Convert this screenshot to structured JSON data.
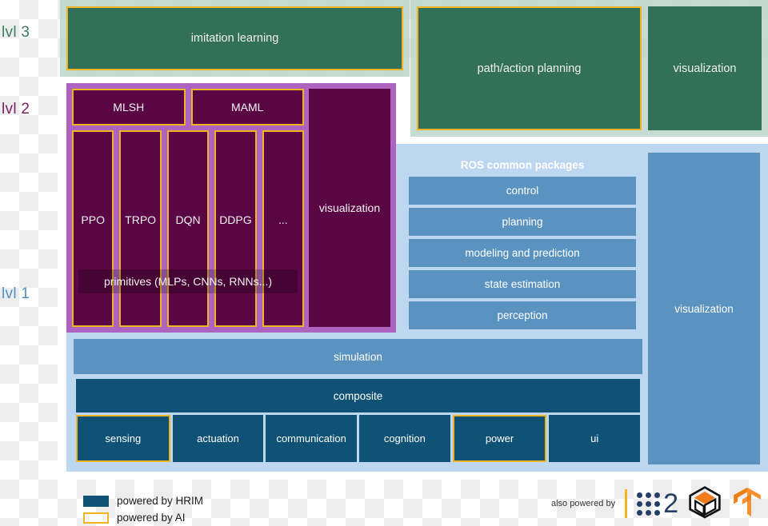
{
  "levels": [
    {
      "id": "lvl3",
      "label": "lvl 3",
      "color": "#3d7f62"
    },
    {
      "id": "lvl2",
      "label": "lvl 2",
      "color": "#7c2060"
    },
    {
      "id": "lvl1",
      "label": "lvl 1",
      "color": "#4f93c6"
    }
  ],
  "level3": {
    "imitation_learning": "imitation learning",
    "path_action_planning": "path/action planning",
    "visualization": "visualization"
  },
  "level2": {
    "meta_learning": [
      "MLSH",
      "MAML"
    ]
  },
  "level1_rl": {
    "algorithms": [
      "PPO",
      "TRPO",
      "DQN",
      "DDPG",
      "..."
    ],
    "primitives": "primitives (MLPs, CNNs, RNNs...)",
    "visualization": "visualization"
  },
  "ros": {
    "title": "ROS common packages",
    "packages": [
      "control",
      "planning",
      "modeling and prediction",
      "state estimation",
      "perception"
    ]
  },
  "right_column": {
    "visualization": "visualization"
  },
  "simulation": {
    "label": "simulation"
  },
  "composite": {
    "title": "composite",
    "modules": [
      {
        "label": "sensing",
        "ai": true
      },
      {
        "label": "actuation",
        "ai": false
      },
      {
        "label": "communication",
        "ai": false
      },
      {
        "label": "cognition",
        "ai": false
      },
      {
        "label": "power",
        "ai": true
      },
      {
        "label": "ui",
        "ai": false
      }
    ]
  },
  "legend": {
    "hrim": "powered by HRIM",
    "ai": "powered by AI"
  },
  "footer": {
    "also_powered_by": "also powered by",
    "logos": [
      "ros2-logo",
      "gazebo-logo",
      "tensorflow-logo"
    ],
    "ros2_digit": "2"
  },
  "colors": {
    "green_box": "#33705a",
    "green_band": "#b9d4c8",
    "ai_yellow": "#f0b323",
    "maroon": "#5a0645",
    "purple": "#ae63c0",
    "light_blue": "#bcd7ef",
    "mid_blue": "#5b93c0",
    "hrim_blue": "#0f5276"
  }
}
